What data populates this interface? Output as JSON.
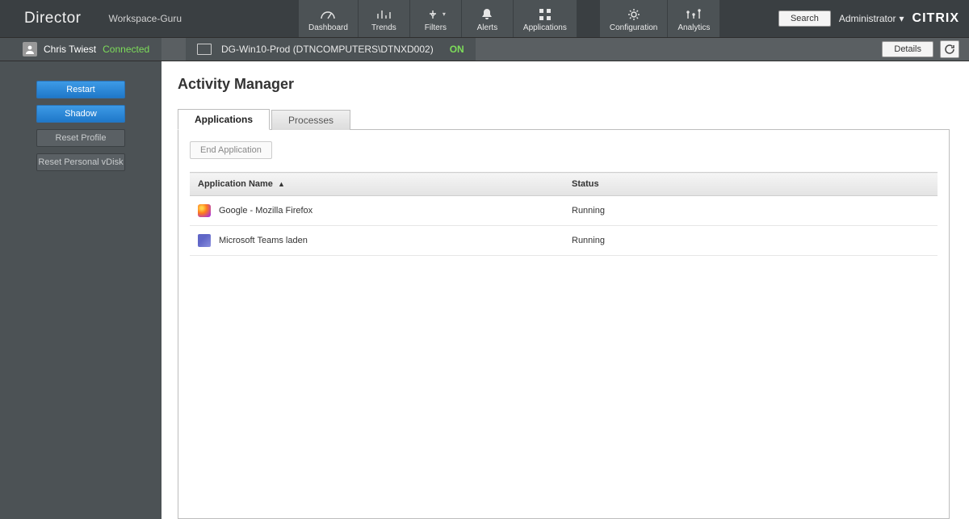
{
  "header": {
    "brand": "Director",
    "workspace": "Workspace-Guru",
    "search_label": "Search",
    "admin_label": "Administrator",
    "logo_text": "CITRIX"
  },
  "nav": {
    "dashboard": "Dashboard",
    "trends": "Trends",
    "filters": "Filters",
    "alerts": "Alerts",
    "applications": "Applications",
    "configuration": "Configuration",
    "analytics": "Analytics"
  },
  "session": {
    "user_name": "Chris Twiest",
    "user_status": "Connected",
    "machine_name": "DG-Win10-Prod (DTNCOMPUTERS\\DTNXD002)",
    "machine_status": "ON",
    "details_label": "Details"
  },
  "sidebar": {
    "restart": "Restart",
    "shadow": "Shadow",
    "reset_profile": "Reset Profile",
    "reset_vdisk": "Reset Personal vDisk"
  },
  "page": {
    "title": "Activity Manager",
    "tab_applications": "Applications",
    "tab_processes": "Processes",
    "end_application": "End Application",
    "col_application_name": "Application Name",
    "col_status": "Status"
  },
  "apps": [
    {
      "icon": "firefox",
      "name": "Google - Mozilla Firefox",
      "status": "Running"
    },
    {
      "icon": "teams",
      "name": "Microsoft Teams laden",
      "status": "Running"
    }
  ]
}
